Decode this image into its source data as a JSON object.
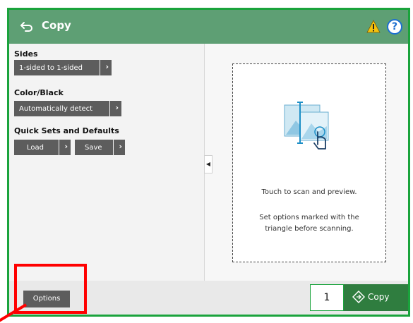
{
  "header": {
    "title": "Copy",
    "icons": [
      "back-arrow-icon",
      "warning-icon",
      "help-icon"
    ],
    "help_glyph": "?"
  },
  "sidebar": {
    "sides_label": "Sides",
    "sides_value": "1-sided to 1-sided",
    "color_label": "Color/Black",
    "color_value": "Automatically detect",
    "quicksets_label": "Quick Sets and Defaults",
    "load_label": "Load",
    "save_label": "Save"
  },
  "preview": {
    "line1": "Touch to scan and preview.",
    "line2a": "Set options marked with the",
    "line2b": "triangle before scanning."
  },
  "footer": {
    "options_label": "Options",
    "copies_value": "1",
    "copy_label": "Copy"
  },
  "colors": {
    "header": "#5e9f74",
    "frame": "#1aa33c",
    "copy_button": "#2f7d3f",
    "button_gray": "#5d5d5d",
    "annotation_red": "#ff0000"
  }
}
